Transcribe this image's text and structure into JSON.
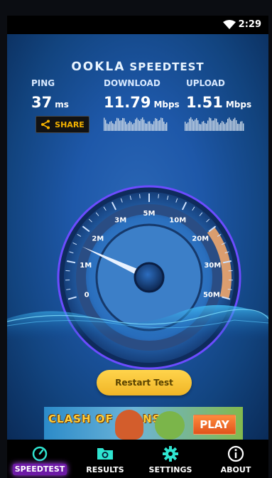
{
  "status_bar": {
    "time": "2:29"
  },
  "header": {
    "brand": "OOKLA",
    "product": "SPEEDTEST"
  },
  "metrics": {
    "ping": {
      "label": "PING",
      "value": "37",
      "unit": "ms"
    },
    "download": {
      "label": "DOWNLOAD",
      "value": "11.79",
      "unit": "Mbps"
    },
    "upload": {
      "label": "UPLOAD",
      "value": "1.51",
      "unit": "Mbps"
    }
  },
  "share_label": "SHARE",
  "gauge": {
    "ticks": [
      "0",
      "1M",
      "2M",
      "3M",
      "5M",
      "10M",
      "20M",
      "30M",
      "50M"
    ],
    "current_mbps": 1.51
  },
  "restart_label": "Restart Test",
  "ad": {
    "title": "CLASH OF CLANS",
    "button": "PLAY"
  },
  "tabs": [
    {
      "label": "SPEEDTEST",
      "icon": "speedometer-icon",
      "active": true
    },
    {
      "label": "RESULTS",
      "icon": "folder-icon",
      "active": false
    },
    {
      "label": "SETTINGS",
      "icon": "gear-icon",
      "active": false
    },
    {
      "label": "ABOUT",
      "icon": "info-icon",
      "active": false
    }
  ],
  "colors": {
    "accent_yellow": "#f5b300",
    "active_tab": "#6d19a6",
    "gauge_purple": "#8b5cff",
    "gauge_orange": "#f0a66b",
    "teal_icons": "#2fe4d0"
  }
}
